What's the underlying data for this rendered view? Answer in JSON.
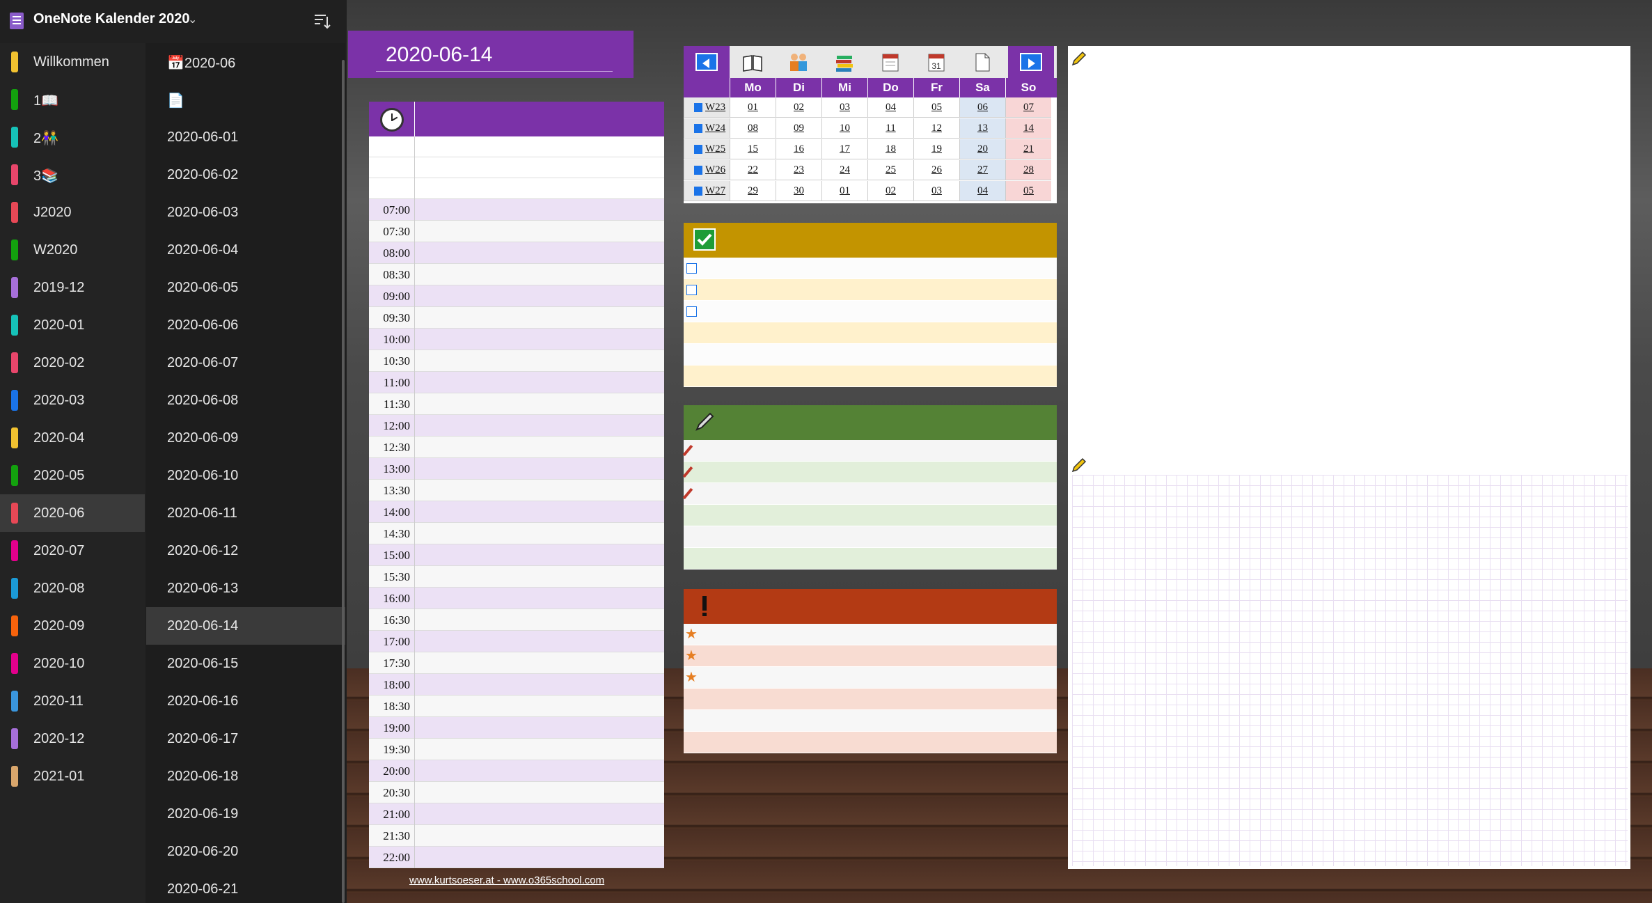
{
  "notebook": {
    "title": "OneNote Kalender 2020"
  },
  "sections": [
    {
      "label": "Willkommen",
      "color": "#f2c230"
    },
    {
      "label": "1📖",
      "color": "#13a10e"
    },
    {
      "label": "2👫",
      "color": "#16c2b8"
    },
    {
      "label": "3📚",
      "color": "#e8466b"
    },
    {
      "label": "J2020",
      "color": "#e74856"
    },
    {
      "label": "W2020",
      "color": "#13a10e"
    },
    {
      "label": "2019-12",
      "color": "#a66fd9"
    },
    {
      "label": "2020-01",
      "color": "#16c2b8"
    },
    {
      "label": "2020-02",
      "color": "#e8466b"
    },
    {
      "label": "2020-03",
      "color": "#1a73e8"
    },
    {
      "label": "2020-04",
      "color": "#f2c230"
    },
    {
      "label": "2020-05",
      "color": "#13a10e"
    },
    {
      "label": "2020-06",
      "color": "#e74856"
    },
    {
      "label": "2020-07",
      "color": "#e3008c"
    },
    {
      "label": "2020-08",
      "color": "#1b9ad6"
    },
    {
      "label": "2020-09",
      "color": "#f7630c"
    },
    {
      "label": "2020-10",
      "color": "#e3008c"
    },
    {
      "label": "2020-11",
      "color": "#3a96dd"
    },
    {
      "label": "2020-12",
      "color": "#a66fd9"
    },
    {
      "label": "2021-01",
      "color": "#d9a66c"
    }
  ],
  "selected_section": "2020-06",
  "pages": [
    {
      "label": "📅2020-06"
    },
    {
      "label": "📄"
    },
    {
      "label": "2020-06-01"
    },
    {
      "label": "2020-06-02"
    },
    {
      "label": "2020-06-03"
    },
    {
      "label": "2020-06-04"
    },
    {
      "label": "2020-06-05"
    },
    {
      "label": "2020-06-06"
    },
    {
      "label": "2020-06-07"
    },
    {
      "label": "2020-06-08"
    },
    {
      "label": "2020-06-09"
    },
    {
      "label": "2020-06-10"
    },
    {
      "label": "2020-06-11"
    },
    {
      "label": "2020-06-12"
    },
    {
      "label": "2020-06-13"
    },
    {
      "label": "2020-06-14"
    },
    {
      "label": "2020-06-15"
    },
    {
      "label": "2020-06-16"
    },
    {
      "label": "2020-06-17"
    },
    {
      "label": "2020-06-18"
    },
    {
      "label": "2020-06-19"
    },
    {
      "label": "2020-06-20"
    },
    {
      "label": "2020-06-21"
    }
  ],
  "selected_page": "2020-06-14",
  "page": {
    "date": "2020-06-14"
  },
  "schedule": {
    "times": [
      "07:00",
      "07:30",
      "08:00",
      "08:30",
      "09:00",
      "09:30",
      "10:00",
      "10:30",
      "11:00",
      "11:30",
      "12:00",
      "12:30",
      "13:00",
      "13:30",
      "14:00",
      "14:30",
      "15:00",
      "15:30",
      "16:00",
      "16:30",
      "17:00",
      "17:30",
      "18:00",
      "18:30",
      "19:00",
      "19:30",
      "20:00",
      "20:30",
      "21:00",
      "21:30",
      "22:00"
    ]
  },
  "credits": {
    "text": "www.kurtsoeser.at - www.o365school.com"
  },
  "calendar": {
    "days": [
      "Mo",
      "Di",
      "Mi",
      "Do",
      "Fr",
      "Sa",
      "So"
    ],
    "weeks": [
      {
        "label": "W23",
        "days": [
          "01",
          "02",
          "03",
          "04",
          "05",
          "06",
          "07"
        ]
      },
      {
        "label": "W24",
        "days": [
          "08",
          "09",
          "10",
          "11",
          "12",
          "13",
          "14"
        ]
      },
      {
        "label": "W25",
        "days": [
          "15",
          "16",
          "17",
          "18",
          "19",
          "20",
          "21"
        ]
      },
      {
        "label": "W26",
        "days": [
          "22",
          "23",
          "24",
          "25",
          "26",
          "27",
          "28"
        ]
      },
      {
        "label": "W27",
        "days": [
          "29",
          "30",
          "01",
          "02",
          "03",
          "04",
          "05"
        ]
      }
    ],
    "toolbar_icons": [
      "prev-arrow-icon",
      "book-icon",
      "people-icon",
      "books-icon",
      "calendar-page-icon",
      "calendar-31-icon",
      "document-icon",
      "next-arrow-icon"
    ],
    "calendar_icon_number": "31"
  },
  "colors": {
    "purple": "#7b32a8",
    "todo": "#c39400",
    "notes": "#548235",
    "important": "#b33a14"
  }
}
